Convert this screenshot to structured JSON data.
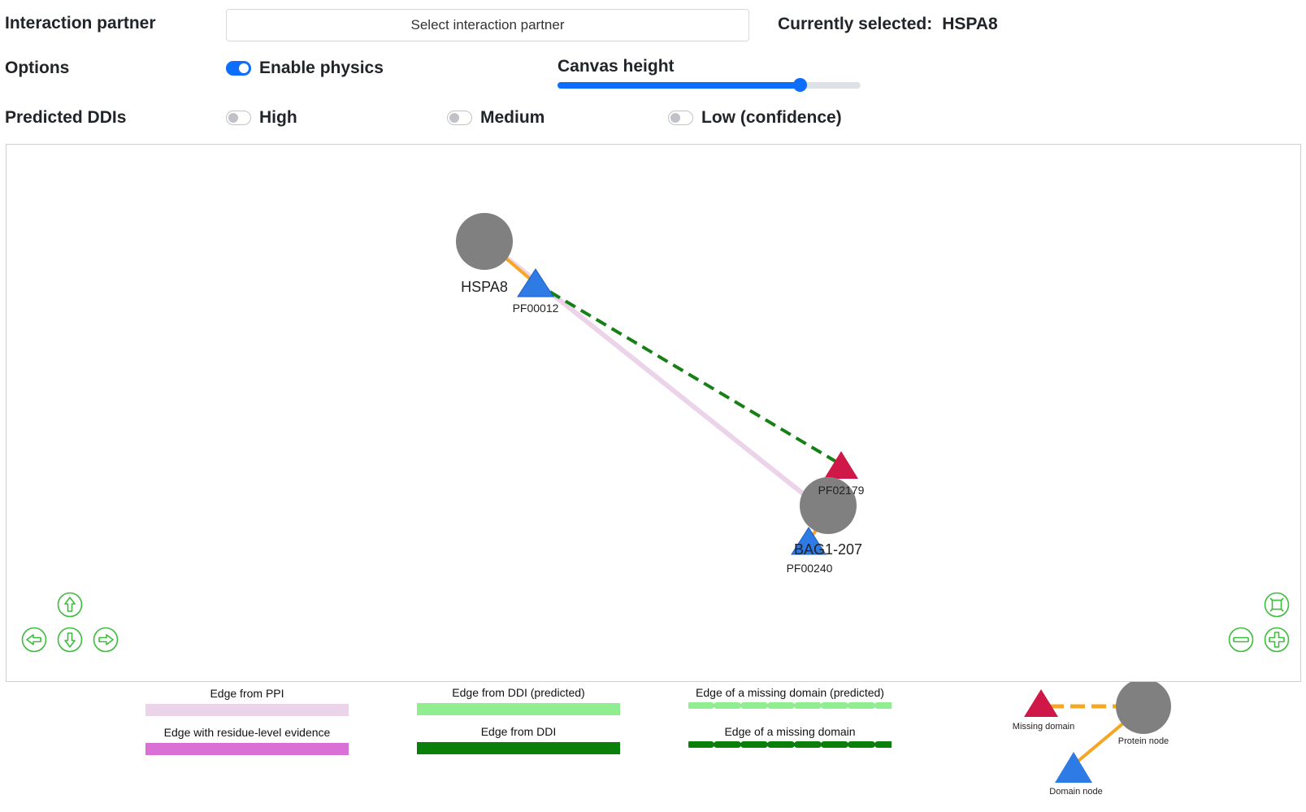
{
  "header": {
    "interaction_partner_label": "Interaction partner",
    "select_button_label": "Select interaction partner",
    "currently_selected_label": "Currently selected:",
    "currently_selected_value": "HSPA8"
  },
  "options": {
    "label": "Options",
    "physics_label": "Enable physics",
    "physics_enabled": true,
    "canvas_height_label": "Canvas height",
    "canvas_height_fraction": 0.8
  },
  "ddis": {
    "label": "Predicted DDIs",
    "high": "High",
    "medium": "Medium",
    "low": "Low (confidence)",
    "high_on": false,
    "medium_on": false,
    "low_on": false
  },
  "network": {
    "nodes": {
      "hspa8": "HSPA8",
      "pf00012": "PF00012",
      "pf02179": "PF02179",
      "bag1": "BAG1-207",
      "pf00240": "PF00240"
    },
    "colors": {
      "protein": "#808080",
      "domain": "#2e7be6",
      "missing_domain": "#d01848",
      "ppi_edge": "#ebd3ea",
      "ddi_edge": "#168016",
      "domain_link": "#f5a623",
      "nav_green": "#3dbd3d"
    }
  },
  "navigation": {
    "up": "arrow-up-icon",
    "down": "arrow-down-icon",
    "left": "arrow-left-icon",
    "right": "arrow-right-icon",
    "fit": "fit-icon",
    "zoom_out": "zoom-out-icon",
    "zoom_in": "zoom-in-icon"
  },
  "legend": {
    "ppi": "Edge from PPI",
    "residue": "Edge with residue-level evidence",
    "ddi_predicted": "Edge from DDI (predicted)",
    "ddi": "Edge from DDI",
    "missing_predicted": "Edge of a missing domain (predicted)",
    "missing": "Edge of a missing domain",
    "missing_domain_node": "Missing domain",
    "protein_node": "Protein node",
    "domain_node": "Domain node",
    "colors": {
      "ppi": "#ebd3ea",
      "residue": "#da70d6",
      "ddi_predicted": "#90ee90",
      "ddi": "#0a800a",
      "missing_predicted": "#90ee90",
      "missing": "#0a800a"
    }
  }
}
